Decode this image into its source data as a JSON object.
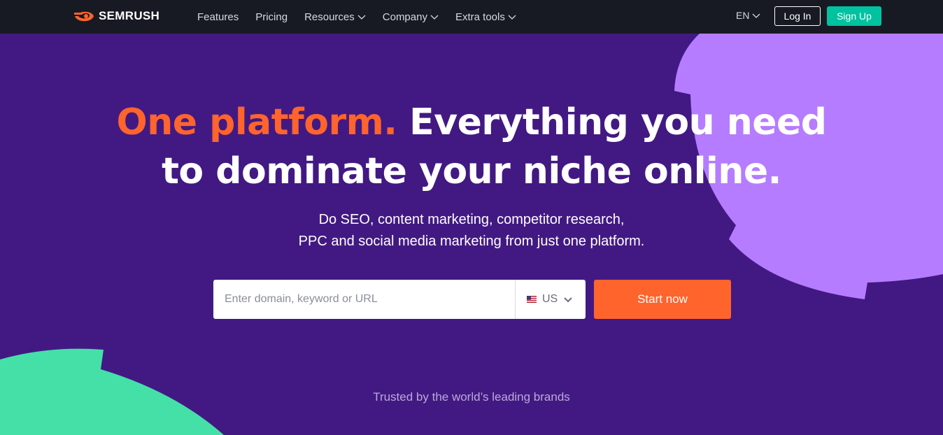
{
  "brand": {
    "name": "SEMRUSH"
  },
  "nav": {
    "items": [
      {
        "label": "Features",
        "dropdown": false
      },
      {
        "label": "Pricing",
        "dropdown": false
      },
      {
        "label": "Resources",
        "dropdown": true
      },
      {
        "label": "Company",
        "dropdown": true
      },
      {
        "label": "Extra tools",
        "dropdown": true
      }
    ],
    "language": "EN",
    "login_label": "Log In",
    "signup_label": "Sign Up"
  },
  "hero": {
    "title_accent": "One platform.",
    "title_rest_line1": "Everything you need",
    "title_line2": "to dominate your niche online.",
    "subtitle_line1": "Do SEO, content marketing, competitor research,",
    "subtitle_line2": "PPC and social media marketing from just one platform."
  },
  "search": {
    "placeholder": "Enter domain, keyword or URL",
    "value": "",
    "database_label": "US",
    "database_icon": "us-flag-icon",
    "submit_label": "Start now"
  },
  "trusted": {
    "text": "Trusted by the world’s leading brands"
  },
  "colors": {
    "background": "#421983",
    "topbar": "#171A22",
    "accent_orange": "#FF642D",
    "accent_teal": "#00C2A0",
    "shape_lavender": "#B57CFF",
    "shape_green": "#45E0A8"
  }
}
